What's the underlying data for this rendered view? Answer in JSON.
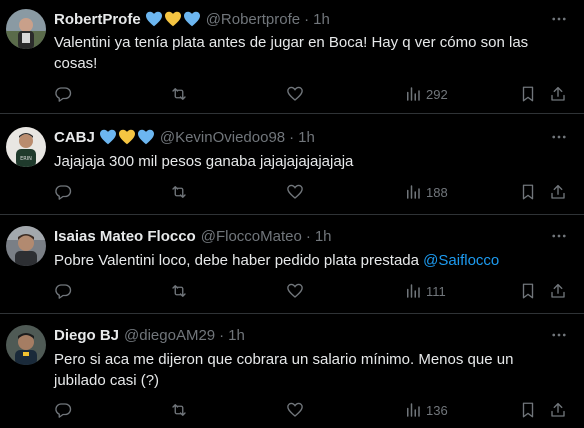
{
  "colors": {
    "background": "#000000",
    "text": "#e7e9ea",
    "muted": "#71767b",
    "link": "#1d9bf0",
    "heart_blue": "#6cb6f0",
    "heart_yellow": "#f5c542"
  },
  "tweets": [
    {
      "name": "RobertProfe",
      "handle": "@Robertprofe",
      "dot": "·",
      "time": "1h",
      "hearts": [
        "blue-heart",
        "yellow-heart",
        "blue-heart"
      ],
      "text": "Valentini ya tenía plata antes de jugar en Boca! Hay q ver cómo son las cosas!",
      "views": "292"
    },
    {
      "name": "CABJ",
      "handle": "@KevinOviedoo98",
      "dot": "·",
      "time": "1h",
      "hearts": [
        "blue-heart",
        "yellow-heart",
        "blue-heart"
      ],
      "text": "Jajajaja 300 mil pesos ganaba jajajajajajajaja",
      "views": "188"
    },
    {
      "name": "Isaias Mateo Flocco",
      "handle": "@FloccoMateo",
      "dot": "·",
      "time": "1h",
      "text": "Pobre Valentini loco, debe haber pedido plata prestada",
      "mention": "@Saiflocco",
      "views": "111"
    },
    {
      "name": "Diego BJ",
      "handle": "@diegoAM29",
      "dot": "·",
      "time": "1h",
      "text": "Pero si aca me dijeron que cobrara un salario mínimo. Menos que un jubilado casi (?)",
      "views": "136"
    }
  ]
}
